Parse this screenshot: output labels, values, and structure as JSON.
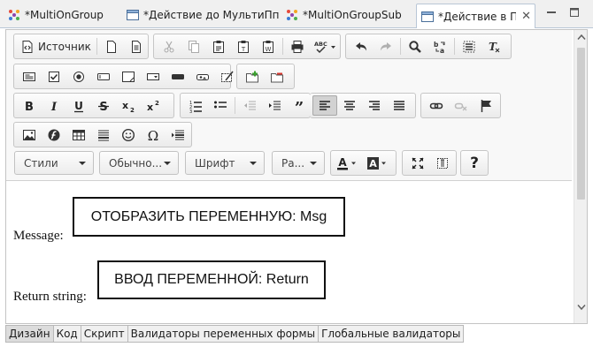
{
  "tabs": [
    {
      "label": "*MultiOnGroup",
      "icon": "multi-group-icon"
    },
    {
      "label": "*Действие до МультиПп",
      "icon": "form-icon"
    },
    {
      "label": "*MultiOnGroupSub",
      "icon": "multi-group-icon"
    },
    {
      "label": "*Действие в Пп",
      "icon": "form-icon",
      "active": true
    }
  ],
  "toolbar": {
    "source_label": "Источник",
    "styles_combo": "Стили",
    "format_combo": "Обычно...",
    "font_combo": "Шрифт",
    "size_combo": "Ра...",
    "help_label": "?"
  },
  "content": {
    "message_label": "Message:",
    "message_field": "ОТОБРАЗИТЬ ПЕРЕМЕННУЮ: Msg",
    "return_label": "Return string:",
    "return_field": "ВВОД ПЕРЕМЕННОЙ: Return"
  },
  "bottom_tabs": [
    "Дизайн",
    "Код",
    "Скрипт",
    "Валидаторы переменных формы",
    "Глобальные валидаторы"
  ],
  "colors": {
    "tab_border": "#b9c6d6",
    "toolbar_bg": "#f8f8f8",
    "active_button": "#d2d2d2"
  }
}
